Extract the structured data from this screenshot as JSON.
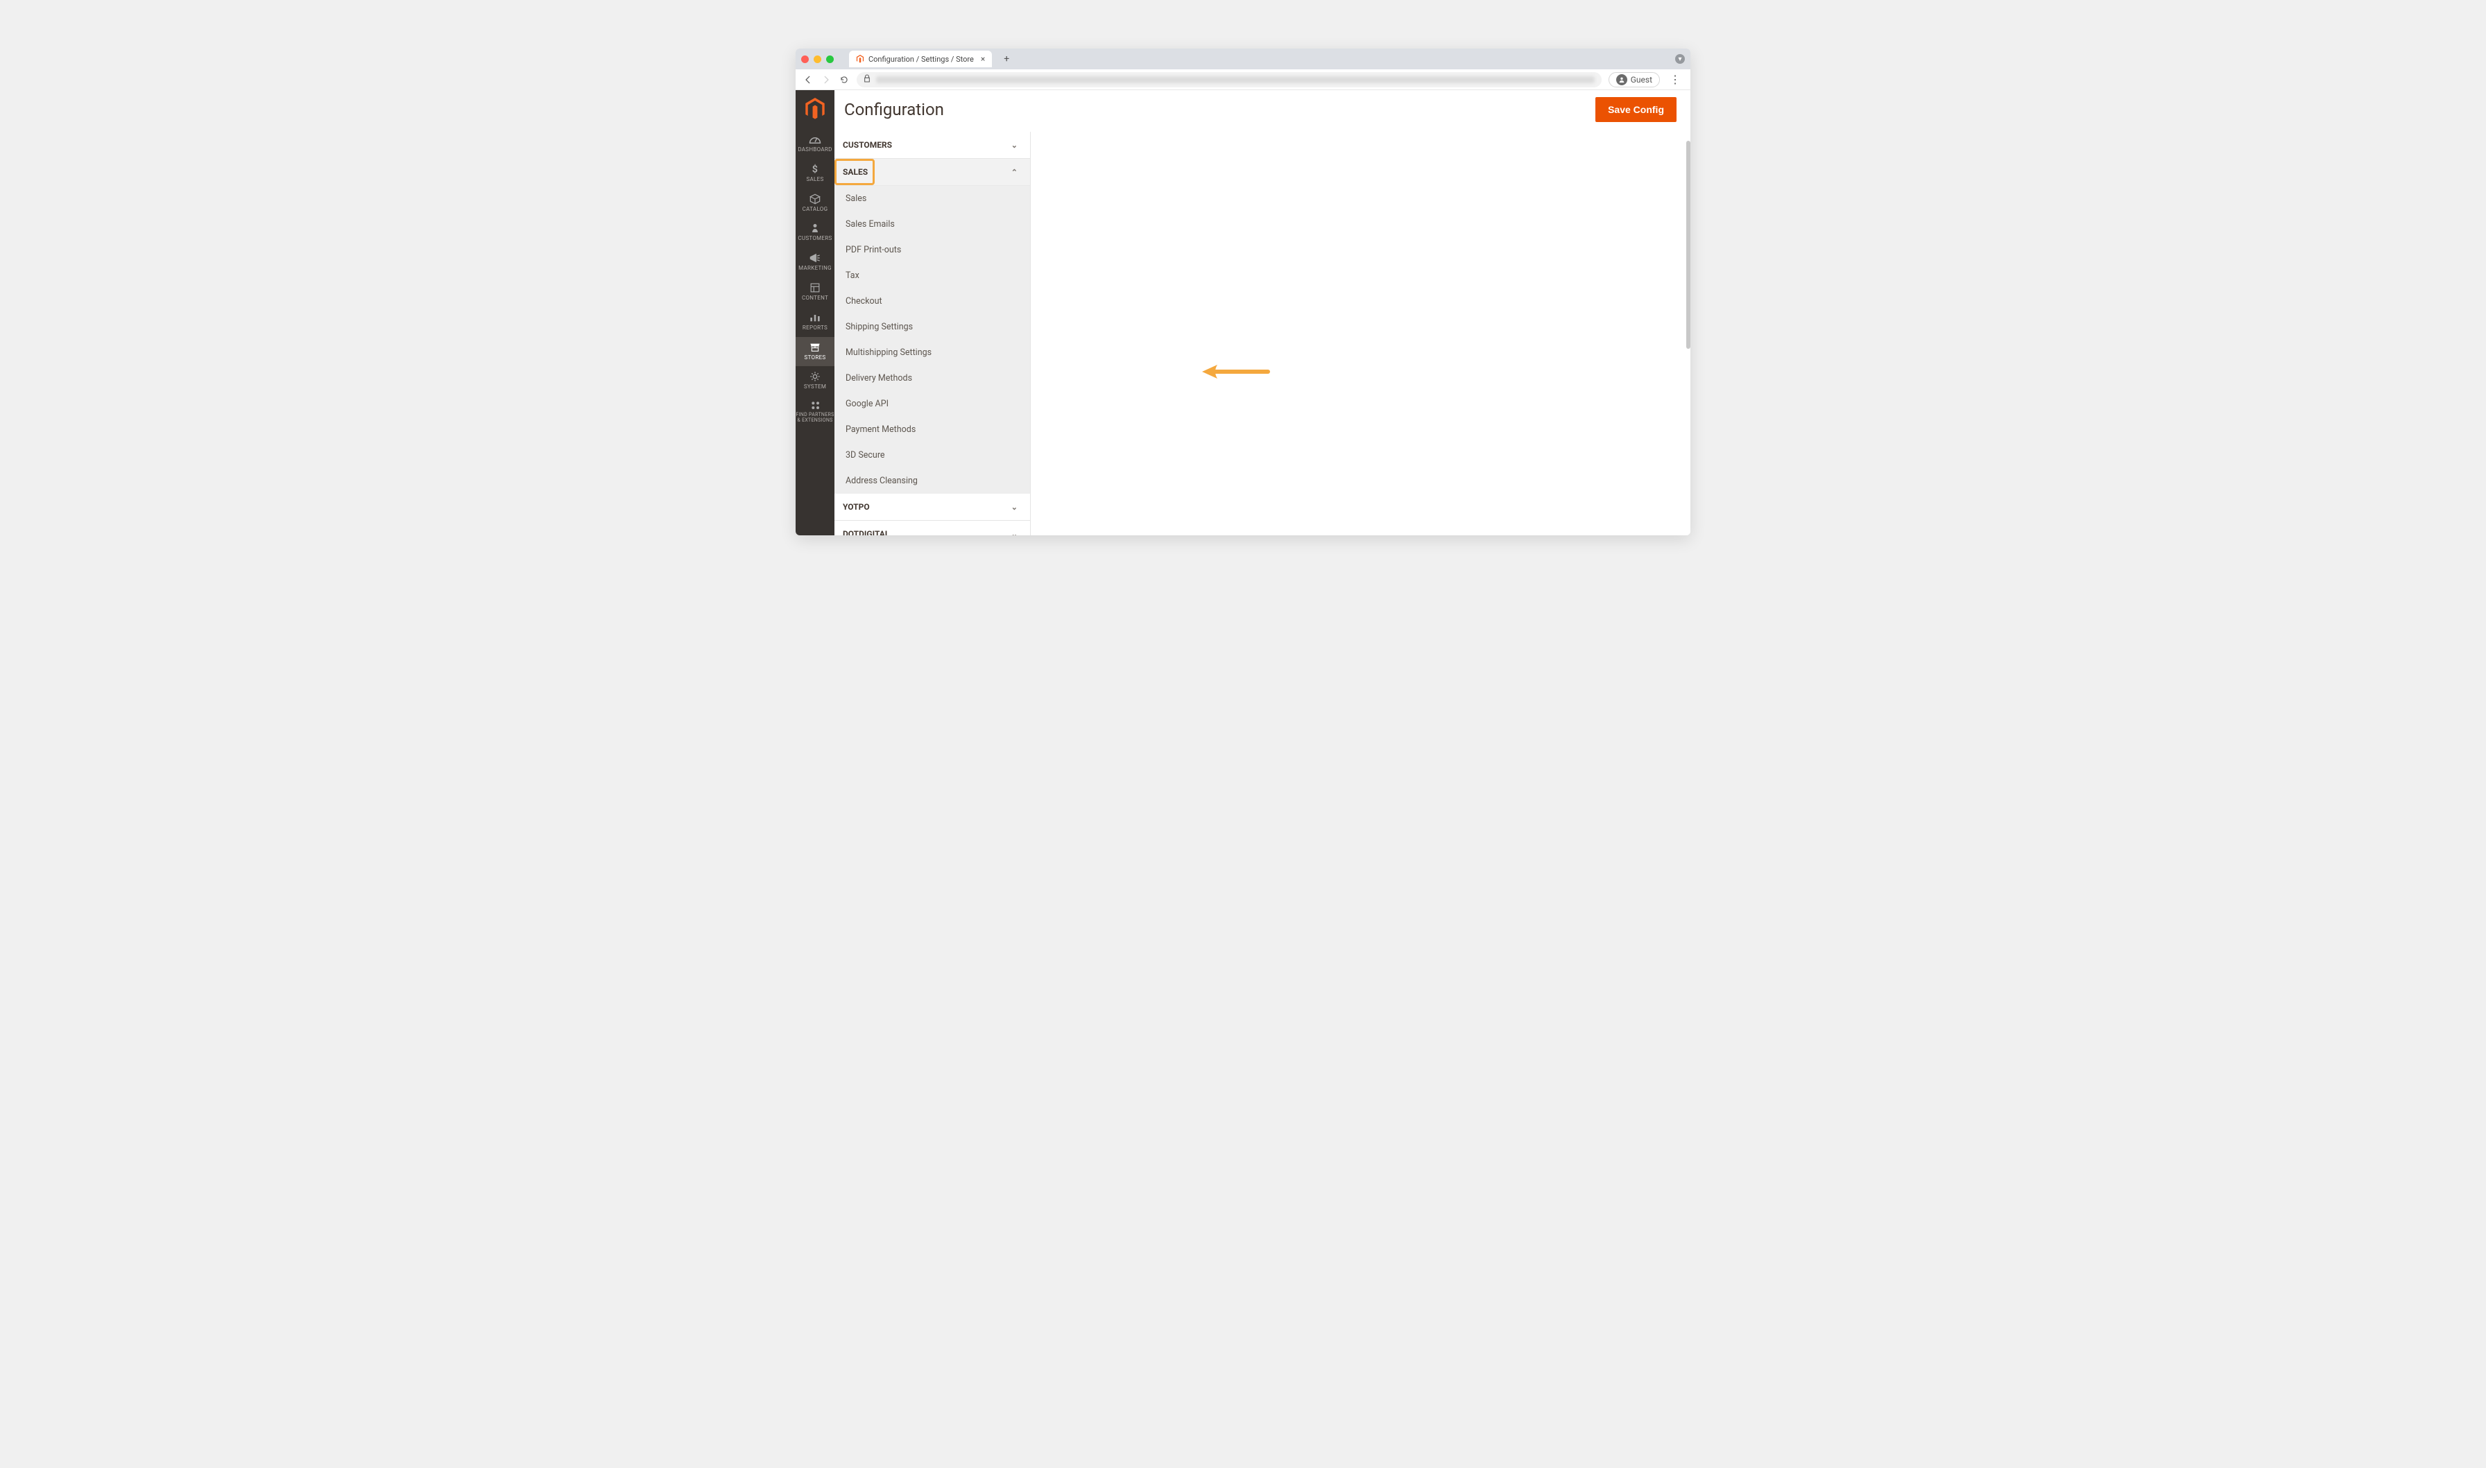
{
  "browser": {
    "tab_title": "Configuration / Settings / Store",
    "guest_label": "Guest"
  },
  "page": {
    "title": "Configuration",
    "save_button": "Save Config"
  },
  "admin_nav": [
    {
      "label": "DASHBOARD"
    },
    {
      "label": "SALES"
    },
    {
      "label": "CATALOG"
    },
    {
      "label": "CUSTOMERS"
    },
    {
      "label": "MARKETING"
    },
    {
      "label": "CONTENT"
    },
    {
      "label": "REPORTS"
    },
    {
      "label": "STORES"
    },
    {
      "label": "SYSTEM"
    },
    {
      "label": "FIND PARTNERS & EXTENSIONS"
    }
  ],
  "config_sections": {
    "customers": {
      "label": "CUSTOMERS"
    },
    "sales": {
      "label": "SALES",
      "items": [
        "Sales",
        "Sales Emails",
        "PDF Print-outs",
        "Tax",
        "Checkout",
        "Shipping Settings",
        "Multishipping Settings",
        "Delivery Methods",
        "Google API",
        "Payment Methods",
        "3D Secure",
        "Address Cleansing"
      ]
    },
    "yotpo": {
      "label": "YOTPO"
    },
    "dotdigital": {
      "label": "DOTDIGITAL"
    }
  }
}
